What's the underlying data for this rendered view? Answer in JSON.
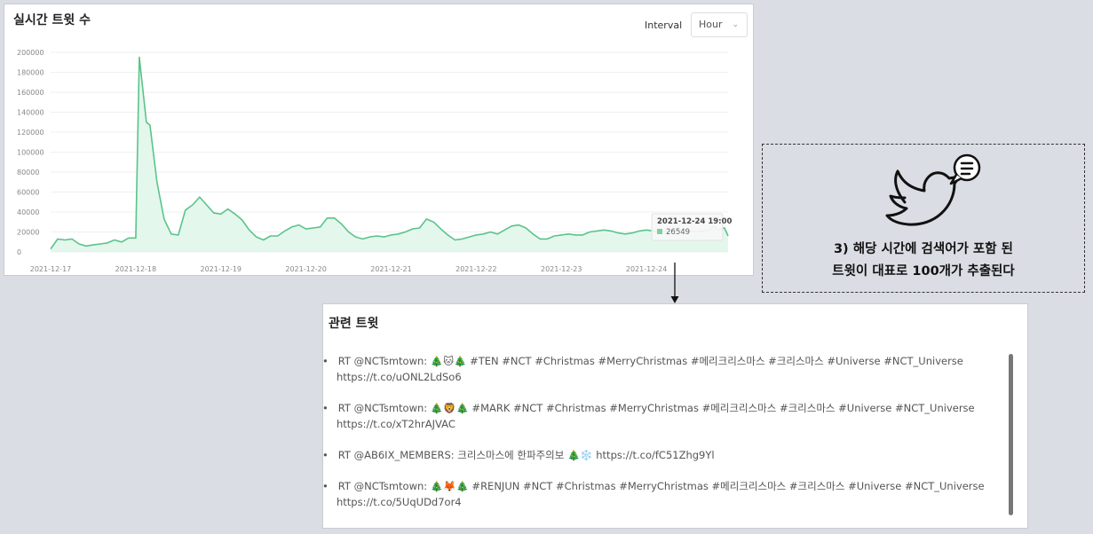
{
  "chart_card": {
    "title": "실시간 트윗 수",
    "interval_label": "Interval",
    "interval_value": "Hour"
  },
  "chart_data": {
    "type": "area",
    "title": "",
    "xlabel": "",
    "ylabel": "",
    "ylim": [
      0,
      200000
    ],
    "yticks": [
      0,
      20000,
      40000,
      60000,
      80000,
      100000,
      120000,
      140000,
      160000,
      180000,
      200000
    ],
    "xlim": [
      "2021-12-17 00:00",
      "2021-12-24 23:00"
    ],
    "xticks": [
      "2021-12-17",
      "2021-12-18",
      "2021-12-19",
      "2021-12-20",
      "2021-12-21",
      "2021-12-22",
      "2021-12-23",
      "2021-12-24"
    ],
    "grid": true,
    "line_color": "#5ac48a",
    "fill_color": "#e4f7ec",
    "series": [
      {
        "x": [
          "2021-12-17 00:00",
          "2021-12-17 02:00",
          "2021-12-17 04:00",
          "2021-12-17 06:00",
          "2021-12-17 08:00",
          "2021-12-17 10:00",
          "2021-12-17 12:00",
          "2021-12-17 14:00",
          "2021-12-17 16:00",
          "2021-12-17 18:00",
          "2021-12-17 20:00",
          "2021-12-17 22:00",
          "2021-12-18 00:00",
          "2021-12-18 01:00",
          "2021-12-18 03:00",
          "2021-12-18 04:00",
          "2021-12-18 06:00",
          "2021-12-18 08:00",
          "2021-12-18 10:00",
          "2021-12-18 12:00",
          "2021-12-18 14:00",
          "2021-12-18 16:00",
          "2021-12-18 18:00",
          "2021-12-18 20:00",
          "2021-12-18 22:00",
          "2021-12-19 00:00",
          "2021-12-19 02:00",
          "2021-12-19 04:00",
          "2021-12-19 06:00",
          "2021-12-19 08:00",
          "2021-12-19 10:00",
          "2021-12-19 12:00",
          "2021-12-19 14:00",
          "2021-12-19 16:00",
          "2021-12-19 18:00",
          "2021-12-19 20:00",
          "2021-12-19 22:00",
          "2021-12-20 00:00",
          "2021-12-20 02:00",
          "2021-12-20 04:00",
          "2021-12-20 06:00",
          "2021-12-20 08:00",
          "2021-12-20 10:00",
          "2021-12-20 12:00",
          "2021-12-20 14:00",
          "2021-12-20 16:00",
          "2021-12-20 18:00",
          "2021-12-20 20:00",
          "2021-12-20 22:00",
          "2021-12-21 00:00",
          "2021-12-21 02:00",
          "2021-12-21 04:00",
          "2021-12-21 06:00",
          "2021-12-21 08:00",
          "2021-12-21 10:00",
          "2021-12-21 12:00",
          "2021-12-21 14:00",
          "2021-12-21 16:00",
          "2021-12-21 18:00",
          "2021-12-21 20:00",
          "2021-12-21 22:00",
          "2021-12-22 00:00",
          "2021-12-22 02:00",
          "2021-12-22 04:00",
          "2021-12-22 06:00",
          "2021-12-22 08:00",
          "2021-12-22 10:00",
          "2021-12-22 12:00",
          "2021-12-22 14:00",
          "2021-12-22 16:00",
          "2021-12-22 18:00",
          "2021-12-22 20:00",
          "2021-12-22 22:00",
          "2021-12-23 00:00",
          "2021-12-23 02:00",
          "2021-12-23 04:00",
          "2021-12-23 06:00",
          "2021-12-23 08:00",
          "2021-12-23 10:00",
          "2021-12-23 12:00",
          "2021-12-23 14:00",
          "2021-12-23 16:00",
          "2021-12-23 18:00",
          "2021-12-23 20:00",
          "2021-12-23 22:00",
          "2021-12-24 00:00",
          "2021-12-24 02:00",
          "2021-12-24 04:00",
          "2021-12-24 06:00",
          "2021-12-24 08:00",
          "2021-12-24 10:00",
          "2021-12-24 12:00",
          "2021-12-24 14:00",
          "2021-12-24 16:00",
          "2021-12-24 18:00",
          "2021-12-24 19:00",
          "2021-12-24 20:00",
          "2021-12-24 22:00",
          "2021-12-24 23:00"
        ],
        "y": [
          3000,
          13000,
          12000,
          13000,
          8000,
          6000,
          7000,
          8000,
          9000,
          12000,
          10000,
          14000,
          14000,
          195000,
          130000,
          127000,
          70000,
          33000,
          18000,
          17000,
          42000,
          47000,
          55000,
          47000,
          39000,
          38000,
          43000,
          38000,
          32000,
          22000,
          15000,
          12000,
          16000,
          16000,
          21000,
          25000,
          27000,
          23000,
          24000,
          25000,
          34000,
          34000,
          28000,
          20000,
          15000,
          13000,
          15000,
          16000,
          15000,
          17000,
          18000,
          20000,
          23000,
          24000,
          33000,
          30000,
          23000,
          17000,
          12000,
          13000,
          15000,
          17000,
          18000,
          20000,
          18000,
          22000,
          26000,
          27000,
          24000,
          18000,
          13000,
          13000,
          16000,
          17000,
          18000,
          17000,
          17000,
          20000,
          21000,
          22000,
          21000,
          19000,
          18000,
          19000,
          21000,
          22000,
          21000,
          20000,
          21000,
          22000,
          22000,
          21000,
          20000,
          21000,
          22000,
          26549,
          22000,
          24000,
          16000
        ]
      }
    ],
    "tooltip": {
      "title": "2021-12-24 19:00",
      "value": "26549",
      "x": "2021-12-24 19:00"
    }
  },
  "tweets_card": {
    "title": "관련 트윗",
    "items": [
      {
        "bullet": "•",
        "text": "RT @NCTsmtown: 🎄🐱🎄 #TEN #NCT #Christmas #MerryChristmas #메리크리스마스 #크리스마스 #Universe #NCT_Universe https://t.co/uONL2LdSo6"
      },
      {
        "bullet": "•",
        "text": "RT @NCTsmtown: 🎄🦁🎄 #MARK #NCT #Christmas #MerryChristmas #메리크리스마스 #크리스마스 #Universe #NCT_Universe https://t.co/xT2hrAJVAC"
      },
      {
        "bullet": "•",
        "text": "RT @AB6IX_MEMBERS: 크리스마스에 한파주의보 🎄❄️ https://t.co/fC51Zhg9Yl"
      },
      {
        "bullet": "•",
        "text": "RT @NCTsmtown: 🎄🦊🎄 #RENJUN #NCT #Christmas #MerryChristmas #메리크리스마스 #크리스마스 #Universe #NCT_Universe https://t.co/5UqUDd7or4"
      }
    ]
  },
  "callout": {
    "line1": "3) 해당 시간에 검색어가 포함 된",
    "line2": "트윗이 대표로 100개가 추출된다",
    "icon": "twitter-bird-speech-bubble-icon"
  }
}
